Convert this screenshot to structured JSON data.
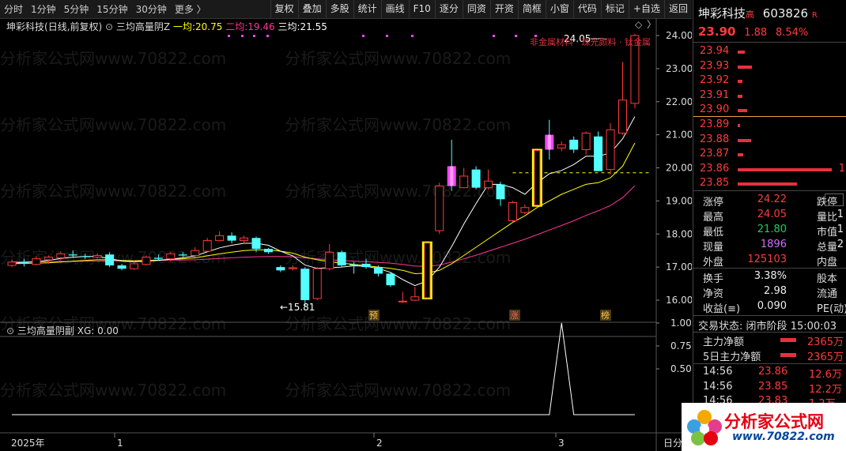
{
  "toolbar": {
    "timeframes": [
      "分时",
      "1分钟",
      "5分钟",
      "15分钟",
      "30分钟",
      "更多 〉"
    ],
    "buttons": [
      "复权",
      "叠加",
      "多股",
      "统计",
      "画线",
      "F10",
      "逐分",
      "同资",
      "开资",
      "简框",
      "小窗",
      "代码",
      "标记",
      "+自选",
      "返回"
    ]
  },
  "chart": {
    "stock_label": "坤彩科技",
    "period_label": "(日线,前复权)",
    "indicator_name": "三均高量阴Z",
    "ma1_label": "一均:",
    "ma1_value": "20.75",
    "ma2_label": "二均:",
    "ma2_value": "19.46",
    "ma3_label": "三均:",
    "ma3_value": "21.55",
    "high_label": "24.05",
    "low_label": "15.81",
    "top_right_text": "非金属材料 · 珠光颜料 · 钛金属",
    "markers": [
      "预",
      "涨",
      "榜"
    ],
    "sub_indicator_name": "三均高量阴副",
    "xg_label": "XG:",
    "xg_value": "0.00",
    "axis_bottom_left": "2025年",
    "date_labels": [
      "1",
      "2",
      "3"
    ],
    "bottom_right_label": "日分",
    "colors": {
      "up": "#ff3b3b",
      "down": "#54ffff",
      "ma1": "#ffffff",
      "ma2": "#ffff00",
      "ma3": "#ff3399",
      "highlight": "#ffff00"
    }
  },
  "chart_data": {
    "type": "candlestick",
    "y_ticks": [
      16.0,
      17.0,
      18.0,
      19.0,
      20.0,
      21.0,
      22.0,
      23.0,
      24.0
    ],
    "sub_y_ticks": [
      0.5,
      0.75,
      1.0
    ],
    "candles": [
      [
        17.05,
        17.15,
        17.22,
        17.0
      ],
      [
        17.15,
        17.1,
        17.25,
        17.02
      ],
      [
        17.08,
        17.25,
        17.32,
        17.05
      ],
      [
        17.22,
        17.3,
        17.35,
        17.1
      ],
      [
        17.28,
        17.4,
        17.48,
        17.2
      ],
      [
        17.38,
        17.35,
        17.5,
        17.28
      ],
      [
        17.33,
        17.3,
        17.4,
        17.25
      ],
      [
        17.3,
        17.35,
        17.42,
        17.26
      ],
      [
        17.38,
        17.05,
        17.45,
        17.0
      ],
      [
        17.05,
        16.95,
        17.1,
        16.9
      ],
      [
        16.95,
        17.1,
        17.18,
        16.92
      ],
      [
        17.08,
        17.3,
        17.35,
        17.05
      ],
      [
        17.28,
        17.25,
        17.38,
        17.2
      ],
      [
        17.25,
        17.4,
        17.45,
        17.18
      ],
      [
        17.38,
        17.35,
        17.45,
        17.3
      ],
      [
        17.35,
        17.5,
        17.6,
        17.3
      ],
      [
        17.48,
        17.8,
        17.88,
        17.45
      ],
      [
        17.8,
        17.95,
        18.08,
        17.78
      ],
      [
        17.95,
        17.8,
        18.05,
        17.72
      ],
      [
        17.8,
        17.88,
        17.95,
        17.7
      ],
      [
        17.88,
        17.55,
        17.92,
        17.45
      ],
      [
        17.55,
        17.45,
        17.58,
        17.4
      ],
      [
        17.0,
        16.9,
        17.05,
        16.85
      ],
      [
        16.95,
        16.98,
        17.05,
        16.9
      ],
      [
        16.95,
        16.0,
        17.0,
        15.81
      ],
      [
        16.05,
        16.95,
        17.0,
        16.0
      ],
      [
        16.95,
        17.45,
        17.7,
        16.9
      ],
      [
        17.45,
        17.05,
        17.5,
        17.0
      ],
      [
        17.08,
        17.05,
        17.15,
        16.8
      ],
      [
        17.1,
        17.0,
        17.25,
        16.95
      ],
      [
        17.0,
        16.8,
        17.05,
        16.72
      ],
      [
        16.8,
        16.45,
        16.85,
        16.4
      ],
      [
        15.95,
        15.97,
        16.25,
        15.92
      ],
      [
        16.0,
        16.1,
        16.4,
        15.98
      ],
      [
        16.05,
        17.75,
        17.78,
        16.05
      ],
      [
        18.1,
        19.45,
        19.55,
        18.0
      ],
      [
        20.05,
        19.45,
        20.85,
        19.3
      ],
      [
        19.4,
        19.75,
        20.0,
        19.4
      ],
      [
        19.95,
        19.4,
        20.05,
        19.35
      ],
      [
        19.4,
        19.6,
        19.95,
        19.35
      ],
      [
        19.5,
        19.05,
        19.58,
        18.85
      ],
      [
        18.4,
        18.95,
        19.0,
        18.35
      ],
      [
        18.65,
        18.8,
        18.9,
        18.6
      ],
      [
        18.85,
        20.55,
        20.58,
        18.8
      ],
      [
        21.0,
        20.55,
        21.45,
        20.25
      ],
      [
        20.6,
        20.7,
        20.8,
        20.5
      ],
      [
        20.85,
        20.55,
        20.95,
        20.45
      ],
      [
        20.55,
        21.05,
        21.1,
        20.4
      ],
      [
        20.95,
        19.9,
        21.1,
        19.9
      ],
      [
        19.95,
        21.15,
        21.35,
        19.8
      ],
      [
        21.05,
        22.05,
        23.2,
        21.0
      ],
      [
        21.95,
        24.0,
        24.05,
        21.8
      ]
    ],
    "ma1": [
      17.12,
      17.14,
      17.16,
      17.2,
      17.26,
      17.3,
      17.32,
      17.32,
      17.26,
      17.18,
      17.16,
      17.18,
      17.2,
      17.24,
      17.28,
      17.34,
      17.46,
      17.58,
      17.66,
      17.72,
      17.72,
      17.66,
      17.48,
      17.34,
      17.06,
      16.96,
      16.98,
      17.0,
      17.04,
      17.02,
      16.96,
      16.84,
      16.62,
      16.44,
      16.58,
      17.0,
      17.62,
      18.3,
      18.92,
      19.5,
      19.5,
      19.4,
      19.2,
      19.55,
      19.82,
      19.92,
      20.1,
      20.35,
      20.35,
      20.45,
      20.88,
      21.55
    ],
    "ma2": [
      17.1,
      17.11,
      17.12,
      17.13,
      17.15,
      17.18,
      17.2,
      17.22,
      17.22,
      17.2,
      17.19,
      17.2,
      17.21,
      17.23,
      17.25,
      17.28,
      17.34,
      17.4,
      17.45,
      17.5,
      17.52,
      17.52,
      17.48,
      17.42,
      17.3,
      17.22,
      17.16,
      17.12,
      17.08,
      17.04,
      17.0,
      16.96,
      16.9,
      16.8,
      16.82,
      16.9,
      17.1,
      17.35,
      17.6,
      17.85,
      18.1,
      18.35,
      18.55,
      18.8,
      19.0,
      19.2,
      19.35,
      19.5,
      19.55,
      19.7,
      20.05,
      20.75
    ],
    "ma3": [
      17.16,
      17.16,
      17.16,
      17.16,
      17.17,
      17.17,
      17.18,
      17.18,
      17.19,
      17.19,
      17.19,
      17.2,
      17.2,
      17.21,
      17.21,
      17.22,
      17.24,
      17.26,
      17.28,
      17.3,
      17.31,
      17.32,
      17.32,
      17.31,
      17.28,
      17.25,
      17.22,
      17.2,
      17.18,
      17.16,
      17.14,
      17.12,
      17.08,
      17.03,
      17.02,
      17.06,
      17.15,
      17.25,
      17.36,
      17.48,
      17.6,
      17.72,
      17.84,
      17.98,
      18.12,
      18.26,
      18.4,
      18.56,
      18.7,
      18.86,
      19.1,
      19.46
    ],
    "signal": [
      0,
      0,
      0,
      0,
      0,
      0,
      0,
      0,
      0,
      0,
      0,
      0,
      0,
      0,
      0,
      0,
      0,
      0,
      0,
      0,
      0,
      0,
      0,
      0,
      0,
      0,
      0,
      0,
      0,
      0,
      0,
      0,
      0,
      0,
      0,
      0,
      0,
      0,
      0,
      0,
      0,
      0,
      0,
      0,
      0,
      1,
      0,
      0,
      0,
      0,
      0,
      0
    ],
    "highlight_bars": [
      34,
      43
    ],
    "dashed_level": 19.85
  },
  "side": {
    "name": "坤彩科技",
    "tag": "高",
    "code": "603826",
    "badge": "R",
    "price": "23.90",
    "change": "1.88",
    "pct": "8.54%",
    "asks": [
      [
        "23.94",
        3
      ],
      [
        "23.93",
        6
      ],
      [
        "23.92",
        2
      ],
      [
        "23.91",
        2
      ],
      [
        "23.90",
        4
      ]
    ],
    "bids": [
      [
        "23.89",
        1
      ],
      [
        "23.88",
        5
      ],
      [
        "23.87",
        2
      ],
      [
        "23.86",
        35
      ],
      [
        "23.85",
        22
      ]
    ],
    "bid_note": "1",
    "stats": [
      {
        "l": "涨停",
        "v": "24.22",
        "l2": "跌停",
        "v2": ""
      },
      {
        "l": "最高",
        "v": "24.05",
        "l2": "量比",
        "v2": "1"
      },
      {
        "l": "最低",
        "v": "21.80",
        "l2": "市值",
        "v2": "1"
      },
      {
        "l": "现量",
        "v": "1896",
        "l2": "总量",
        "v2": "2"
      },
      {
        "l": "外盘",
        "v": "125103",
        "l2": "内盘",
        "v2": ""
      }
    ],
    "stats2": [
      {
        "l": "换手",
        "v": "3.38%",
        "l2": "股本"
      },
      {
        "l": "净资",
        "v": "2.98",
        "l2": "流通"
      },
      {
        "l": "收益(≡)",
        "v": "0.090",
        "l2": "PE(动)"
      }
    ],
    "trade_status_label": "交易状态:",
    "trade_status": "闭市阶段",
    "trade_time": "15:00:03",
    "flow": [
      {
        "l": "主力净额",
        "v": "2365万"
      },
      {
        "l": "5日主力净额",
        "v": "2365万"
      }
    ],
    "ticks": [
      {
        "t": "14:56",
        "p": "23.86",
        "v": "12.6万"
      },
      {
        "t": "14:56",
        "p": "23.85",
        "v": "12.2万"
      },
      {
        "t": "14:56",
        "p": "23.83",
        "v": "1.2万"
      }
    ]
  },
  "watermark": "分析家公式网www.70822.com",
  "logo": {
    "text": "分析家公式网",
    "url": "www.70822.com"
  }
}
